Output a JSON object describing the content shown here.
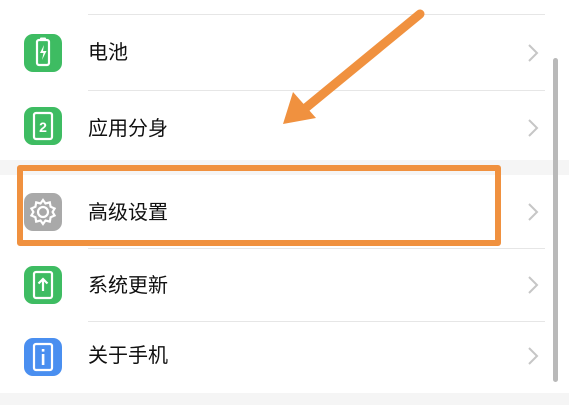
{
  "settings": {
    "items": [
      {
        "label": "电池",
        "icon": "battery-icon",
        "color": "#3ebc62"
      },
      {
        "label": "应用分身",
        "icon": "app-clone-icon",
        "color": "#3ebc62"
      },
      {
        "label": "高级设置",
        "icon": "gear-icon",
        "color": "#a9a9a9"
      },
      {
        "label": "系统更新",
        "icon": "system-update-icon",
        "color": "#3ebc62"
      },
      {
        "label": "关于手机",
        "icon": "about-phone-icon",
        "color": "#4a8ff0"
      }
    ]
  },
  "annotation": {
    "highlight_color": "#f0913f",
    "highlighted_item": "高级设置"
  }
}
